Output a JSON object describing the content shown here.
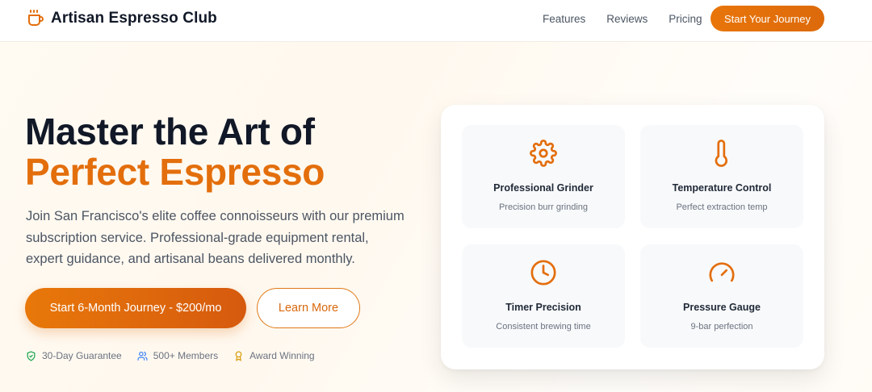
{
  "brand": {
    "name": "Artisan Espresso Club",
    "icon": "coffee-cup-icon",
    "accent": "#e36e0c"
  },
  "nav": {
    "links": [
      "Features",
      "Reviews",
      "Pricing"
    ],
    "cta": "Start Your Journey"
  },
  "hero": {
    "title_line1": "Master the Art of",
    "title_line2": "Perfect Espresso",
    "description": "Join San Francisco's elite coffee connoisseurs with our premium subscription service. Professional-grade equipment rental, expert guidance, and artisanal beans delivered monthly.",
    "primary_cta": "Start 6-Month Journey - $200/mo",
    "secondary_cta": "Learn More",
    "trust": [
      {
        "label": "30-Day Guarantee",
        "icon": "shield-check-icon",
        "color": "#16a34a"
      },
      {
        "label": "500+ Members",
        "icon": "users-icon",
        "color": "#3b82f6"
      },
      {
        "label": "Award Winning",
        "icon": "award-icon",
        "color": "#d99a06"
      }
    ]
  },
  "features": [
    {
      "title": "Professional Grinder",
      "subtitle": "Precision burr grinding",
      "icon": "gear-icon"
    },
    {
      "title": "Temperature Control",
      "subtitle": "Perfect extraction temp",
      "icon": "thermometer-icon"
    },
    {
      "title": "Timer Precision",
      "subtitle": "Consistent brewing time",
      "icon": "clock-icon"
    },
    {
      "title": "Pressure Gauge",
      "subtitle": "9-bar perfection",
      "icon": "gauge-icon"
    }
  ]
}
